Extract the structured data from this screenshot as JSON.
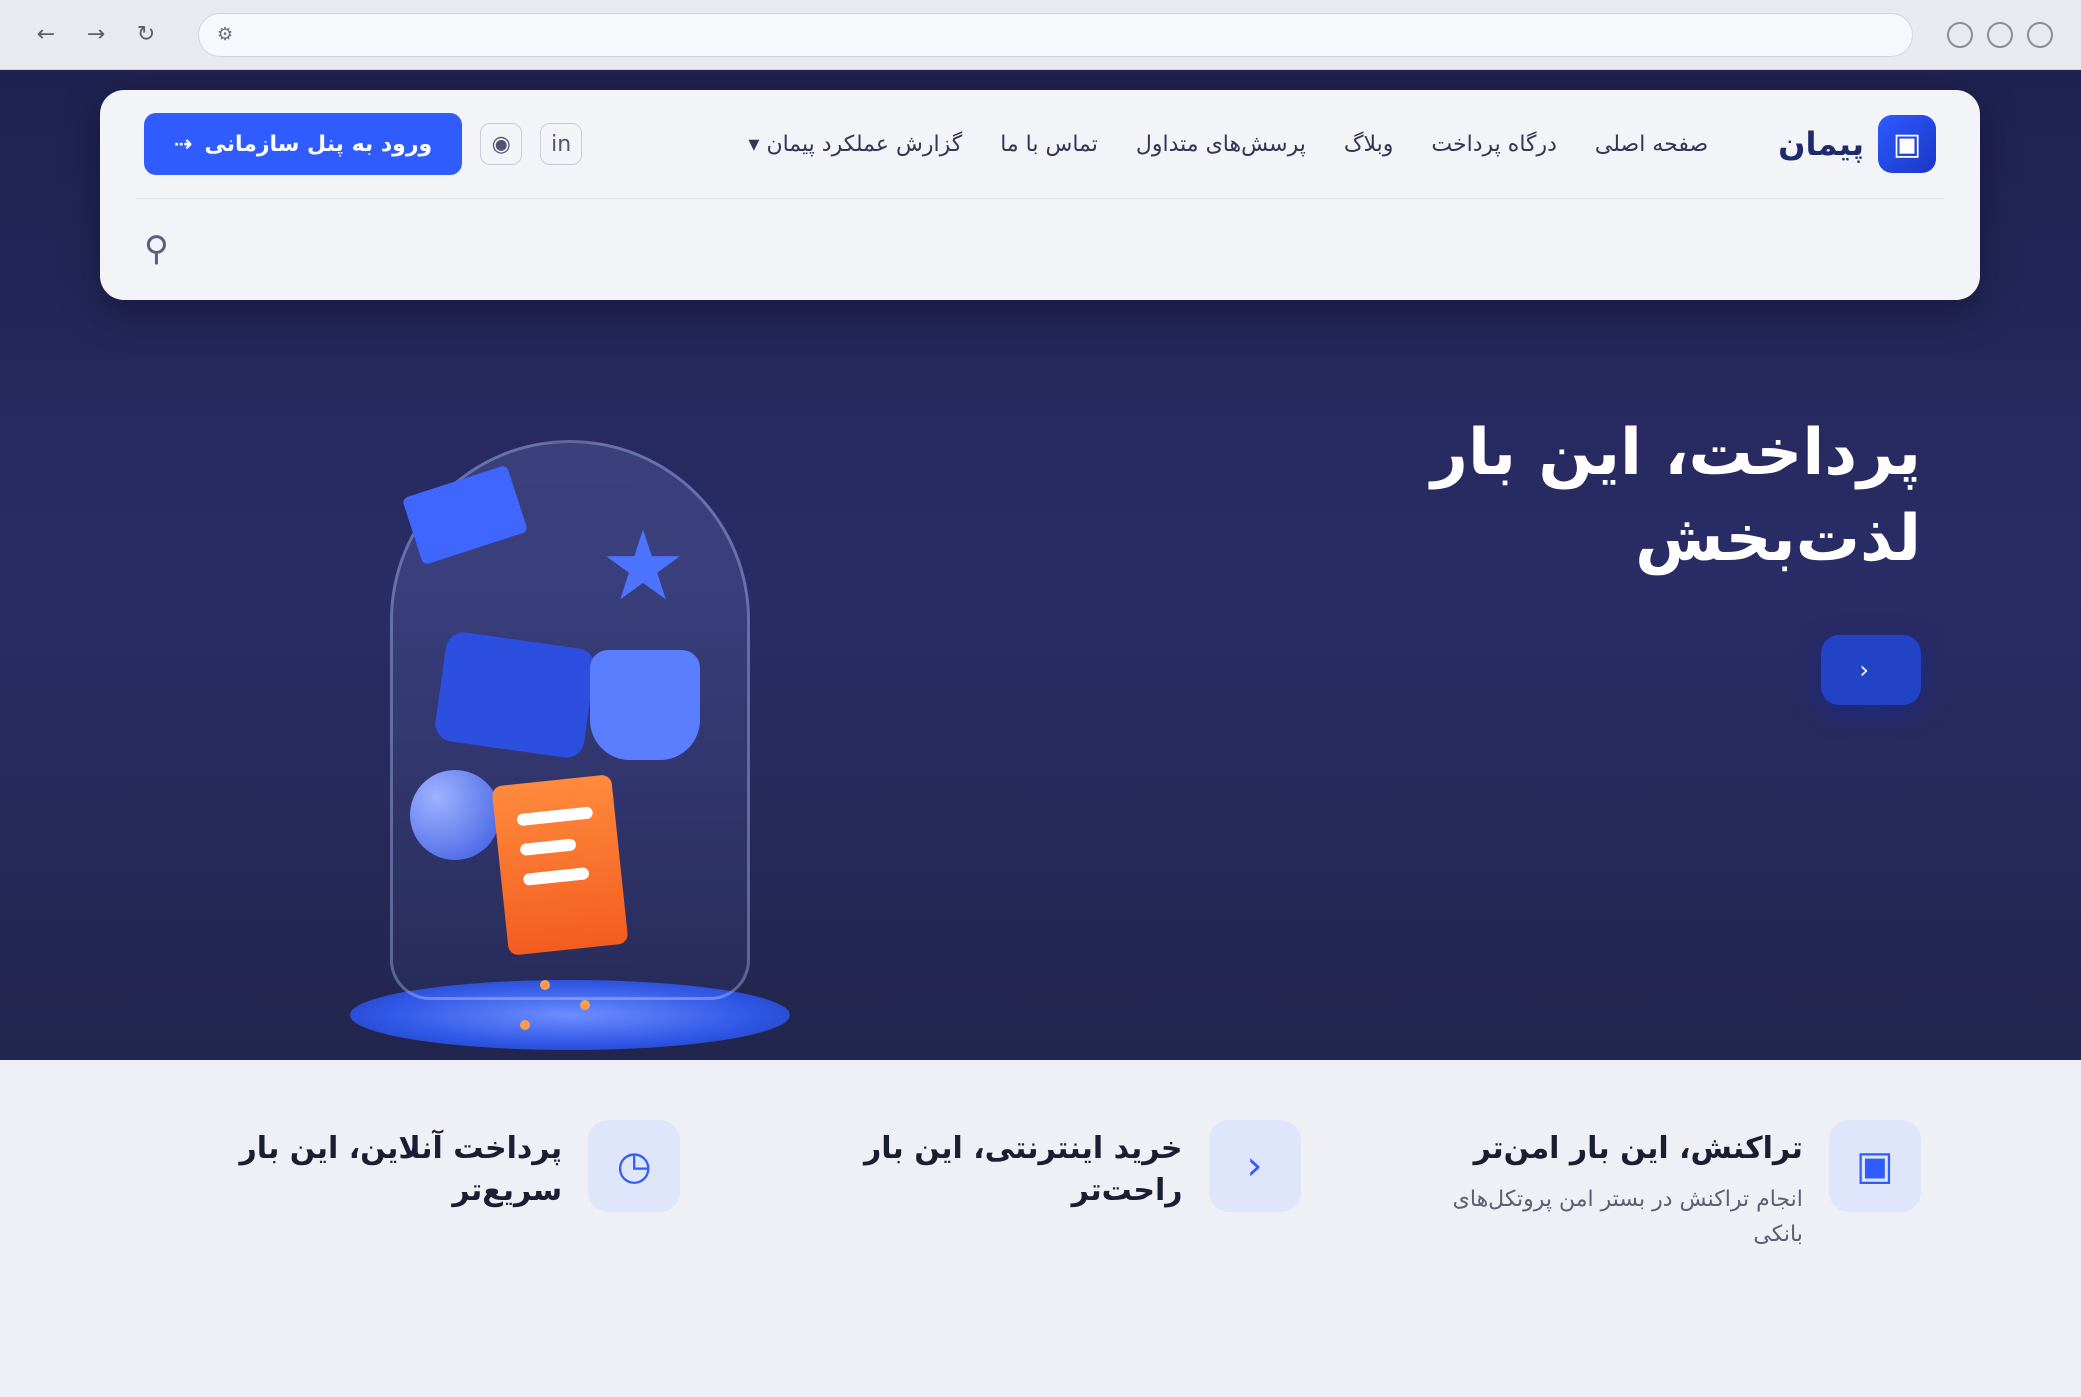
{
  "browser": {
    "url": "",
    "icons": {
      "back": "arrow-left-icon",
      "forward": "arrow-right-icon",
      "reload": "reload-icon",
      "site_info": "site-info-icon"
    }
  },
  "header": {
    "brand": {
      "name": "پیمان",
      "logo_icon": "logo-icon"
    },
    "nav": [
      {
        "label": "صفحه اصلی",
        "active": true
      },
      {
        "label": "درگاه پرداخت",
        "active": false
      },
      {
        "label": "وبلاگ",
        "active": false
      },
      {
        "label": "پرسش‌های متداول",
        "active": false
      },
      {
        "label": "تماس با ما",
        "active": false
      },
      {
        "label": "گزارش عملکرد پیمان",
        "active": false,
        "has_dropdown": true
      }
    ],
    "social_icons": [
      "linkedin-icon",
      "instagram-icon"
    ],
    "panel_button": {
      "label": "ورود به پنل سازمانی",
      "icon": "login-icon"
    },
    "search": {
      "placeholder": "",
      "icon": "search-icon"
    }
  },
  "hero": {
    "title_line1": "پرداخت، این بار",
    "title_line2": "لذت‌بخش",
    "cta": {
      "label": "",
      "icon": "arrow-left-icon"
    },
    "accent_color": "#2343c7"
  },
  "features": [
    {
      "title": "پرداخت آنلاین، این بار سریع‌تر",
      "description": "",
      "icon": "clock-icon"
    },
    {
      "title": "خرید اینترنتی، این بار راحت‌تر",
      "description": "",
      "icon": "chevron-left-icon"
    },
    {
      "title": "تراکنش، این بار امن‌تر",
      "description": "انجام تراکنش در بستر امن پروتکل‌های بانکی",
      "icon": "lock-icon"
    }
  ],
  "colors": {
    "primary": "#2f5bff",
    "hero_bg_top": "#1f2150",
    "hero_bg_bottom": "#1a1b3c",
    "strip_bg": "#eef0f5"
  }
}
